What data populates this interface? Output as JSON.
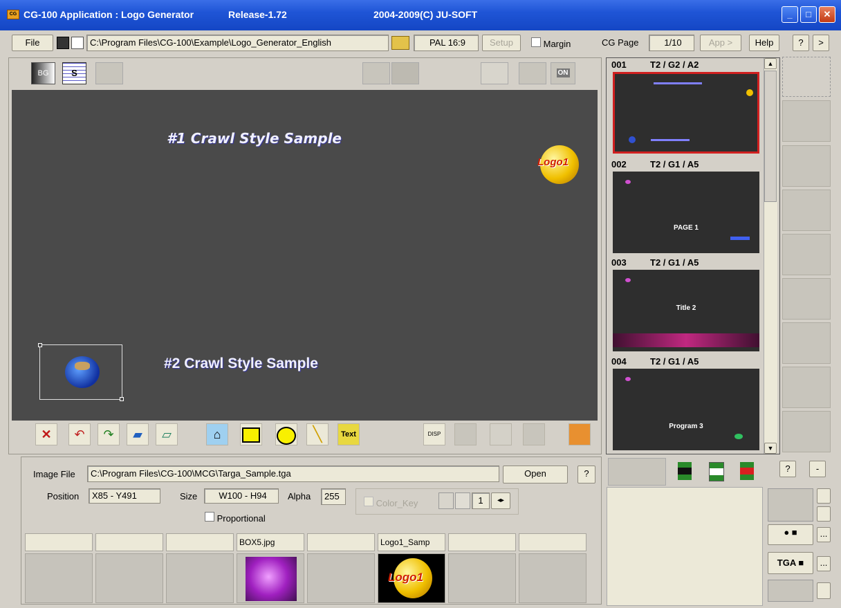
{
  "window": {
    "app_title": "CG-100 Application : Logo Generator",
    "release": "Release-1.72",
    "copyright": "2004-2009(C) JU-SOFT",
    "min": "_",
    "max": "□",
    "close": "✕"
  },
  "toolbar": {
    "file": "File",
    "path": "C:\\Program Files\\CG-100\\Example\\Logo_Generator_English",
    "format": "PAL 16:9",
    "setup": "Setup",
    "margin": "Margin",
    "cg_page_label": "CG Page",
    "cg_page_value": "1/10",
    "app": "App >",
    "help": "Help",
    "question": "?",
    "next": ">"
  },
  "canvas_tools": {
    "bg": "BG",
    "s": "S",
    "on": "ON"
  },
  "canvas": {
    "text1": "#1 Crawl Style Sample",
    "text2": "#2 Crawl Style Sample",
    "logo": "Logo1"
  },
  "bottom_tools": {
    "text": "Text",
    "disp": "DISP"
  },
  "pages": [
    {
      "num": "001",
      "info": "T2 / G2 / A2",
      "caption": ""
    },
    {
      "num": "002",
      "info": "T2 / G1 / A5",
      "caption": "PAGE 1"
    },
    {
      "num": "003",
      "info": "T2 / G1 / A5",
      "caption": "Title 2"
    },
    {
      "num": "004",
      "info": "T2 / G1 / A5",
      "caption": "Program 3"
    }
  ],
  "props": {
    "image_file_label": "Image File",
    "image_file_value": "C:\\Program Files\\CG-100\\MCG\\Targa_Sample.tga",
    "open": "Open",
    "help": "?",
    "position_label": "Position",
    "position_value": "X85 - Y491",
    "size_label": "Size",
    "size_value": "W100 - H94",
    "alpha_label": "Alpha",
    "alpha_value": "255",
    "color_key": "Color_Key",
    "color_key_num": "1",
    "proportional": "Proportional"
  },
  "slots": [
    "",
    "",
    "",
    "BOX5.jpg",
    "",
    "Logo1_Samp",
    "",
    ""
  ],
  "right_panel": {
    "q": "?",
    "minus": "-",
    "tga": "TGA",
    "dots": "..."
  },
  "colors": {
    "title_bar": "#1f55d6",
    "canvas": "#4a4a4a",
    "selected_border": "#d02020"
  }
}
